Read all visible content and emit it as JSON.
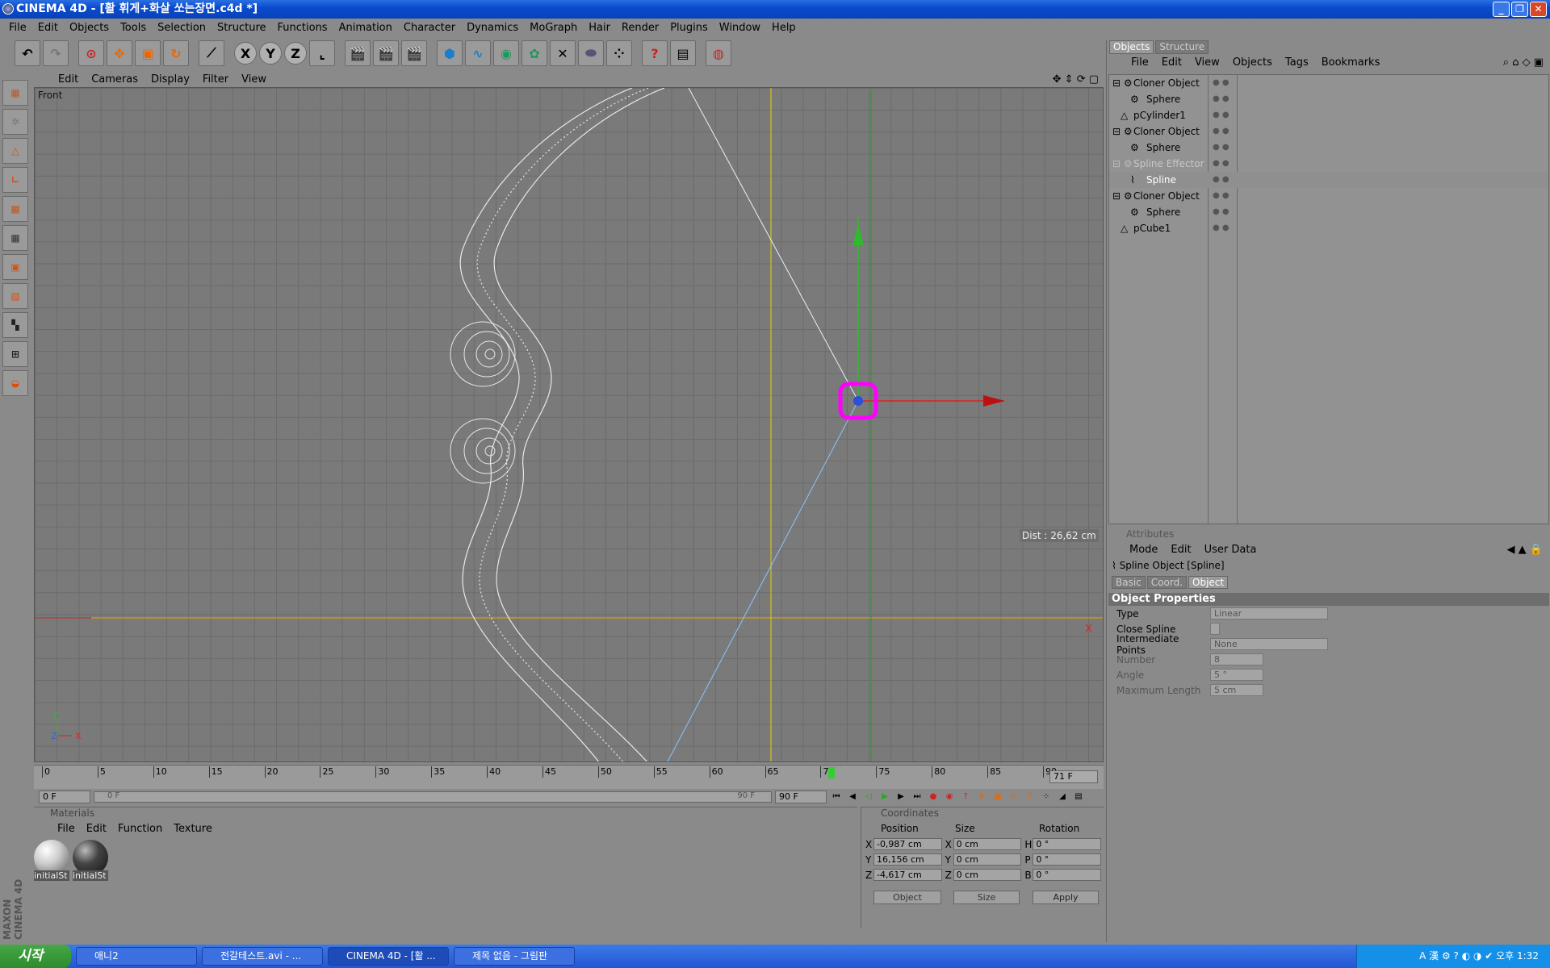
{
  "window": {
    "title": "CINEMA 4D - [활 휘게+화살 쏘는장면.c4d *]",
    "minimize": "_",
    "restore": "❐",
    "close": "✕"
  },
  "menubar": [
    "File",
    "Edit",
    "Objects",
    "Tools",
    "Selection",
    "Structure",
    "Functions",
    "Animation",
    "Character",
    "Dynamics",
    "MoGraph",
    "Hair",
    "Render",
    "Plugins",
    "Window",
    "Help"
  ],
  "toolbar": {
    "axis_x": "X",
    "axis_y": "Y",
    "axis_z": "Z"
  },
  "viewport": {
    "menu": [
      "Edit",
      "Cameras",
      "Display",
      "Filter",
      "View"
    ],
    "label": "Front",
    "dist": "Dist : 26,62 cm",
    "axis_x": "X",
    "corner_axis_y": "Y",
    "corner_axis_z": "Z",
    "corner_axis_x": "X"
  },
  "timeline": {
    "ticks": [
      "0",
      "5",
      "10",
      "15",
      "20",
      "25",
      "30",
      "35",
      "40",
      "45",
      "50",
      "55",
      "60",
      "65",
      "70",
      "75",
      "80",
      "85",
      "90"
    ],
    "current_tick": "71",
    "current_frame": "71 F",
    "start_frame": "0 F",
    "range_start": "0 F",
    "range_end": "90 F",
    "end_frame": "90 F"
  },
  "materials": {
    "header": "Materials",
    "menu": [
      "File",
      "Edit",
      "Function",
      "Texture"
    ],
    "items": [
      {
        "name": "initialSt"
      },
      {
        "name": "initialSt"
      }
    ]
  },
  "coordinates": {
    "header": "Coordinates",
    "col_position": "Position",
    "col_size": "Size",
    "col_rotation": "Rotation",
    "rows": [
      {
        "axis": "X",
        "pos": "-0,987 cm",
        "saxis": "X",
        "size": "0 cm",
        "raxis": "H",
        "rot": "0 °"
      },
      {
        "axis": "Y",
        "pos": "16,156 cm",
        "saxis": "Y",
        "size": "0 cm",
        "raxis": "P",
        "rot": "0 °"
      },
      {
        "axis": "Z",
        "pos": "-4,617 cm",
        "saxis": "Z",
        "size": "0 cm",
        "raxis": "B",
        "rot": "0 °"
      }
    ],
    "mode": "Object",
    "size_mode": "Size",
    "apply": "Apply"
  },
  "objects": {
    "tabs": [
      "Objects",
      "Structure"
    ],
    "menu": [
      "File",
      "Edit",
      "View",
      "Objects",
      "Tags",
      "Bookmarks"
    ],
    "tree": [
      {
        "name": "Cloner Object",
        "level": 0
      },
      {
        "name": "Sphere",
        "level": 1
      },
      {
        "name": "pCylinder1",
        "level": 0
      },
      {
        "name": "Cloner Object",
        "level": 0
      },
      {
        "name": "Sphere",
        "level": 1
      },
      {
        "name": "Spline Effector",
        "level": 0,
        "dim": true
      },
      {
        "name": "Spline",
        "level": 1
      },
      {
        "name": "Cloner Object",
        "level": 0
      },
      {
        "name": "Sphere",
        "level": 1
      },
      {
        "name": "pCube1",
        "level": 0
      }
    ]
  },
  "attributes": {
    "header": "Attributes",
    "menu": [
      "Mode",
      "Edit",
      "User Data"
    ],
    "object_title": "Spline Object [Spline]",
    "tabs": [
      "Basic",
      "Coord.",
      "Object"
    ],
    "section": "Object Properties",
    "props": [
      {
        "label": "Type",
        "value": "Linear"
      },
      {
        "label": "Close Spline",
        "value": ""
      },
      {
        "label": "Intermediate Points",
        "value": "None"
      },
      {
        "label": "Number",
        "value": "8"
      },
      {
        "label": "Angle",
        "value": "5 °"
      },
      {
        "label": "Maximum Length",
        "value": "5 cm"
      }
    ]
  },
  "taskbar": {
    "start": "시작",
    "tasks": [
      "애니2",
      "전갈테스트.avi - ...",
      "CINEMA 4D - [활 ...",
      "제목 없음 - 그림판"
    ],
    "clock": "오후 1:32"
  },
  "brand": "MAXON CINEMA 4D"
}
